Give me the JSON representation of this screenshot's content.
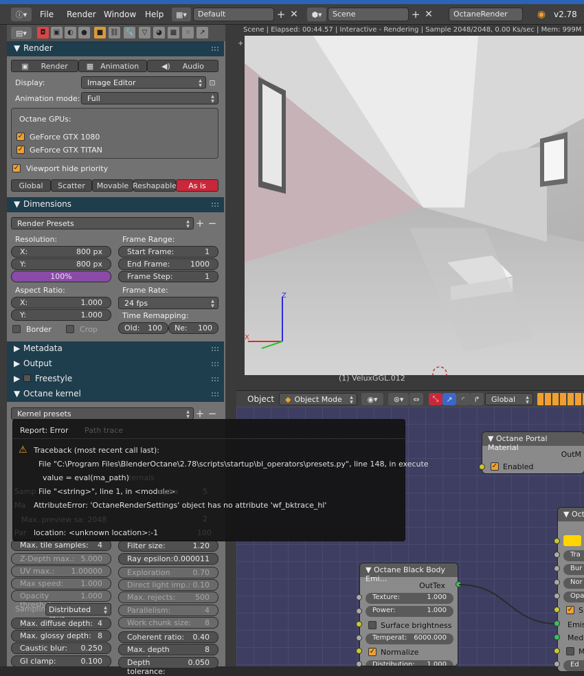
{
  "menus": [
    "File",
    "Render",
    "Window",
    "Help"
  ],
  "layout_field": "Default",
  "scene_field": "Scene",
  "engine_field": "OctaneRender",
  "version": "v2.78",
  "render_section": {
    "title": "Render",
    "buttons": [
      "Render",
      "Animation",
      "Audio"
    ],
    "display_label": "Display:",
    "display_value": "Image Editor",
    "anim_mode_label": "Animation mode:",
    "anim_mode_value": "Full",
    "gpus_label": "Octane GPUs:",
    "gpus": [
      "GeForce GTX 1080",
      "GeForce GTX TITAN"
    ],
    "viewport_hide": "Viewport hide priority",
    "priority_tabs": [
      "Global",
      "Scatter",
      "Movable",
      "Reshapable",
      "As is"
    ]
  },
  "dimensions": {
    "title": "Dimensions",
    "presets": "Render Presets",
    "resolution_label": "Resolution:",
    "res_x_label": "X:",
    "res_x": "800 px",
    "res_y_label": "Y:",
    "res_y": "800 px",
    "res_pct": "100%",
    "aspect_label": "Aspect Ratio:",
    "asp_x_label": "X:",
    "asp_x": "1.000",
    "asp_y_label": "Y:",
    "asp_y": "1.000",
    "border": "Border",
    "crop": "Crop",
    "frame_range_label": "Frame Range:",
    "start_label": "Start Frame:",
    "start": "1",
    "end_label": "End Frame:",
    "end": "1000",
    "step_label": "Frame Step:",
    "step": "1",
    "frame_rate_label": "Frame Rate:",
    "frame_rate": "24 fps",
    "remap_label": "Time Remapping:",
    "old_label": "Old:",
    "old": "100",
    "new_label": "Ne:",
    "new": "100"
  },
  "collapsed": [
    "Metadata",
    "Output",
    "Freestyle"
  ],
  "kernel": {
    "title": "Octane kernel",
    "presets": "Kernel presets",
    "max_tile_label": "Max. tile samples:",
    "max_tile": "4",
    "filter_label": "Filter size:",
    "filter": "1.20",
    "zdepth_label": "Z-Depth max.:",
    "zdepth": "5.000",
    "rayeps_label": "Ray epsilon:",
    "rayeps": "0.000011",
    "uvmax_label": "UV max.:",
    "uvmax": "1.00000",
    "explor_label": "Exploration streng:",
    "explor": "0.70",
    "maxspeed_label": "Max speed:",
    "maxspeed": "1.000",
    "direct_label": "Direct light imp.:",
    "direct": "0.10",
    "opacity_label": "Opacity threshol:",
    "opacity": "1.000",
    "maxrej_label": "Max. rejects:",
    "maxrej": "500",
    "parallel_label": "Parallelism:",
    "parallel": "4",
    "sampling_label": "Samplin",
    "sampling_value": "Distributed rays",
    "workchunk_label": "Work chunk size:",
    "workchunk": "8",
    "diffuse_label": "Max. diffuse depth:",
    "diffuse": "4",
    "coherent_label": "Coherent ratio:",
    "coherent": "0.40",
    "glossy_label": "Max. glossy depth:",
    "glossy": "8",
    "maxdepth_label": "Max. depth samples:",
    "maxdepth": "8",
    "caustic_label": "Caustic blur:",
    "caustic": "0.250",
    "gi_label": "GI clamp:",
    "gi": "0.100",
    "deptol_label": "Depth tolerance:",
    "deptol": "0.050"
  },
  "viewport": {
    "status": "Scene | Elapsed: 00:44.57 | Interactive - Rendering | Sample 2048/2048, 0.00 Ks/sec | Mem: 999M",
    "object_name": "(1) VeluxGGL.012",
    "menu_object": "Object",
    "mode": "Object Mode",
    "orientation": "Global",
    "axis_z": "Z",
    "axis_x": "X"
  },
  "error": {
    "title": "Report: Error",
    "lines": [
      "Traceback (most recent call last):",
      "File \"C:\\Program Files\\BlenderOctane\\2.78\\scripts\\startup\\bl_operators\\presets.py\", line 148, in execute",
      "value = eval(ma_path)",
      "File \"<string>\", line 1, in <module>",
      "AttributeError: 'OctaneRenderSettings' object has no attribute 'wf_bktrace_hl'",
      "location: <unknown location>:-1"
    ],
    "ghost_left": [
      "Path trace",
      "Max. preview sa: 2048",
      "Samp",
      "Ma",
      "Par"
    ],
    "ghost_right": [
      "ternals",
      "alpha",
      "5",
      "2",
      "100"
    ]
  },
  "nodes": {
    "portal": {
      "title": "Octane Portal Material",
      "out": "OutM",
      "enabled": "Enabled"
    },
    "blackbody": {
      "title": "Octane Black Body Emi...",
      "out": "OutTex",
      "texture_label": "Texture:",
      "texture": "1.000",
      "power_label": "Power:",
      "power": "1.000",
      "surface": "Surface brightness",
      "temp_label": "Temperat:",
      "temp": "6000.000",
      "normalize": "Normalize",
      "dist_label": "Distribution:",
      "dist": "1.000"
    },
    "octa": {
      "title": "Octa",
      "rows": [
        "Tra",
        "Bur",
        "Nor",
        "Opa",
        "Sn",
        "Emiss",
        "Medi",
        "M",
        "Ed"
      ]
    }
  }
}
